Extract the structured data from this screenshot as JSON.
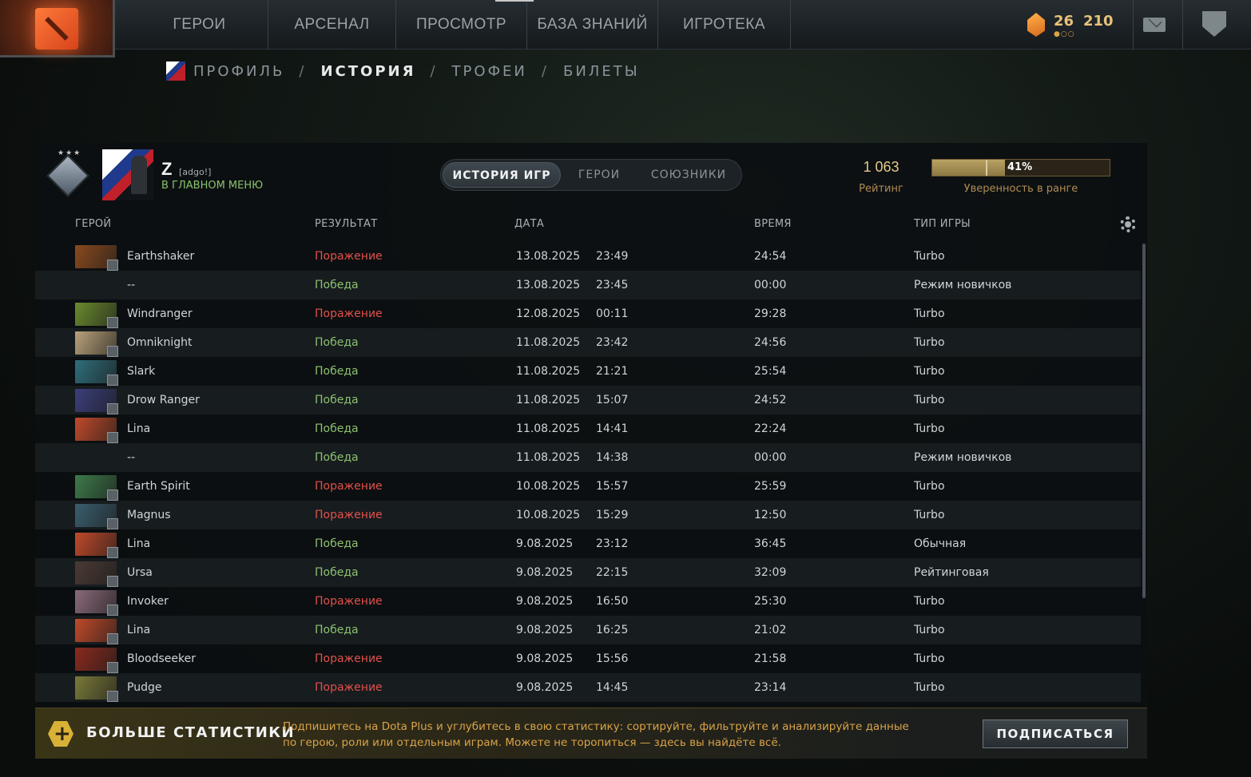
{
  "nav": {
    "items": [
      "ГЕРОИ",
      "АРСЕНАЛ",
      "ПРОСМОТР",
      "БАЗА ЗНАНИЙ",
      "ИГРОТЕКА"
    ],
    "level": "26",
    "currency": "210"
  },
  "subnav": {
    "profile": "ПРОФИЛЬ",
    "history": "ИСТОРИЯ",
    "trophies": "ТРОФЕИ",
    "tickets": "БИЛЕТЫ",
    "sep": "/"
  },
  "player": {
    "name": "Z",
    "tag": "[adgo!]",
    "status": "В ГЛАВНОМ МЕНЮ",
    "rank_stars": "★★★"
  },
  "tabs": [
    "ИСТОРИЯ ИГР",
    "ГЕРОИ",
    "СОЮЗНИКИ"
  ],
  "rating": {
    "value": "1 063",
    "label": "Рейтинг",
    "confidence_percent": 41,
    "confidence_text": "41%",
    "confidence_label": "Уверенность в ранге"
  },
  "columns": {
    "hero": "ГЕРОЙ",
    "result": "РЕЗУЛЬТАТ",
    "date": "ДАТА",
    "time": "ВРЕМЯ",
    "mode": "ТИП ИГРЫ"
  },
  "matches": [
    {
      "hero": "Earthshaker",
      "result": "Поражение",
      "win": false,
      "date": "13.08.2025",
      "clock": "23:49",
      "duration": "24:54",
      "mode": "Turbo",
      "color": "#8a4a1e"
    },
    {
      "hero": "--",
      "result": "Победа",
      "win": true,
      "date": "13.08.2025",
      "clock": "23:45",
      "duration": "00:00",
      "mode": "Режим новичков",
      "color": ""
    },
    {
      "hero": "Windranger",
      "result": "Поражение",
      "win": false,
      "date": "12.08.2025",
      "clock": "00:11",
      "duration": "29:28",
      "mode": "Turbo",
      "color": "#6a8a2e"
    },
    {
      "hero": "Omniknight",
      "result": "Победа",
      "win": true,
      "date": "11.08.2025",
      "clock": "23:42",
      "duration": "24:56",
      "mode": "Turbo",
      "color": "#b9a27a"
    },
    {
      "hero": "Slark",
      "result": "Победа",
      "win": true,
      "date": "11.08.2025",
      "clock": "21:21",
      "duration": "25:54",
      "mode": "Turbo",
      "color": "#2f6e7a"
    },
    {
      "hero": "Drow Ranger",
      "result": "Победа",
      "win": true,
      "date": "11.08.2025",
      "clock": "15:07",
      "duration": "24:52",
      "mode": "Turbo",
      "color": "#3b3f7a"
    },
    {
      "hero": "Lina",
      "result": "Победа",
      "win": true,
      "date": "11.08.2025",
      "clock": "14:41",
      "duration": "22:24",
      "mode": "Turbo",
      "color": "#c04a2a"
    },
    {
      "hero": "--",
      "result": "Победа",
      "win": true,
      "date": "11.08.2025",
      "clock": "14:38",
      "duration": "00:00",
      "mode": "Режим новичков",
      "color": ""
    },
    {
      "hero": "Earth Spirit",
      "result": "Поражение",
      "win": false,
      "date": "10.08.2025",
      "clock": "15:57",
      "duration": "25:59",
      "mode": "Turbo",
      "color": "#3d7a4a"
    },
    {
      "hero": "Magnus",
      "result": "Поражение",
      "win": false,
      "date": "10.08.2025",
      "clock": "15:29",
      "duration": "12:50",
      "mode": "Turbo",
      "color": "#3a5e6e"
    },
    {
      "hero": "Lina",
      "result": "Победа",
      "win": true,
      "date": "9.08.2025",
      "clock": "23:12",
      "duration": "36:45",
      "mode": "Обычная",
      "color": "#c04a2a"
    },
    {
      "hero": "Ursa",
      "result": "Победа",
      "win": true,
      "date": "9.08.2025",
      "clock": "22:15",
      "duration": "32:09",
      "mode": "Рейтинговая",
      "color": "#4a3a34"
    },
    {
      "hero": "Invoker",
      "result": "Поражение",
      "win": false,
      "date": "9.08.2025",
      "clock": "16:50",
      "duration": "25:30",
      "mode": "Turbo",
      "color": "#8a6a7a"
    },
    {
      "hero": "Lina",
      "result": "Победа",
      "win": true,
      "date": "9.08.2025",
      "clock": "16:25",
      "duration": "21:02",
      "mode": "Turbo",
      "color": "#c04a2a"
    },
    {
      "hero": "Bloodseeker",
      "result": "Поражение",
      "win": false,
      "date": "9.08.2025",
      "clock": "15:56",
      "duration": "21:58",
      "mode": "Turbo",
      "color": "#8a2a1e"
    },
    {
      "hero": "Pudge",
      "result": "Поражение",
      "win": false,
      "date": "9.08.2025",
      "clock": "14:45",
      "duration": "23:14",
      "mode": "Turbo",
      "color": "#7a7a3a"
    }
  ],
  "dota_plus": {
    "title": "БОЛЬШЕ СТАТИСТИКИ",
    "description": "Подпишитесь на Dota Plus и углубитесь в свою статистику: сортируйте, фильтруйте и анализируйте данные по герою, роли или отдельным играм. Можете не торопиться — здесь вы найдёте всё.",
    "button": "ПОДПИСАТЬСЯ"
  }
}
